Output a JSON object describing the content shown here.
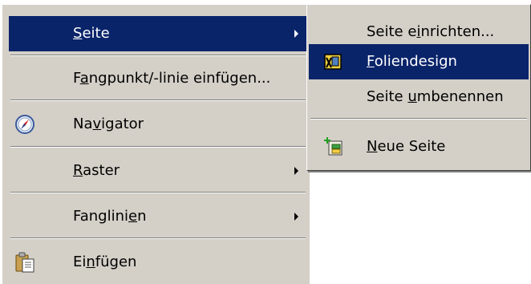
{
  "menu": {
    "items": [
      {
        "pre": "",
        "acc": "S",
        "post": "eite"
      },
      {
        "pre": "F",
        "acc": "a",
        "post": "ngpunkt/-linie einfügen..."
      },
      {
        "pre": "Na",
        "acc": "v",
        "post": "igator"
      },
      {
        "pre": "",
        "acc": "R",
        "post": "aster"
      },
      {
        "pre": "Fanglini",
        "acc": "e",
        "post": "n"
      },
      {
        "pre": "Ei",
        "acc": "n",
        "post": "fügen"
      }
    ]
  },
  "submenu": {
    "items": [
      {
        "pre": "Seite e",
        "acc": "i",
        "post": "nrichten..."
      },
      {
        "pre": "",
        "acc": "F",
        "post": "oliendesign"
      },
      {
        "pre": "Seite ",
        "acc": "u",
        "post": "mbenennen"
      },
      {
        "pre": "",
        "acc": "N",
        "post": "eue Seite"
      }
    ]
  },
  "colors": {
    "menu_bg": "#d4d0c8",
    "highlight": "#0a246a",
    "highlight_text": "#ffffff"
  },
  "icons": {
    "navigator": "compass-icon",
    "paste": "clipboard-paste-icon",
    "slide_design": "slide-design-icon",
    "new_page": "new-page-icon"
  }
}
